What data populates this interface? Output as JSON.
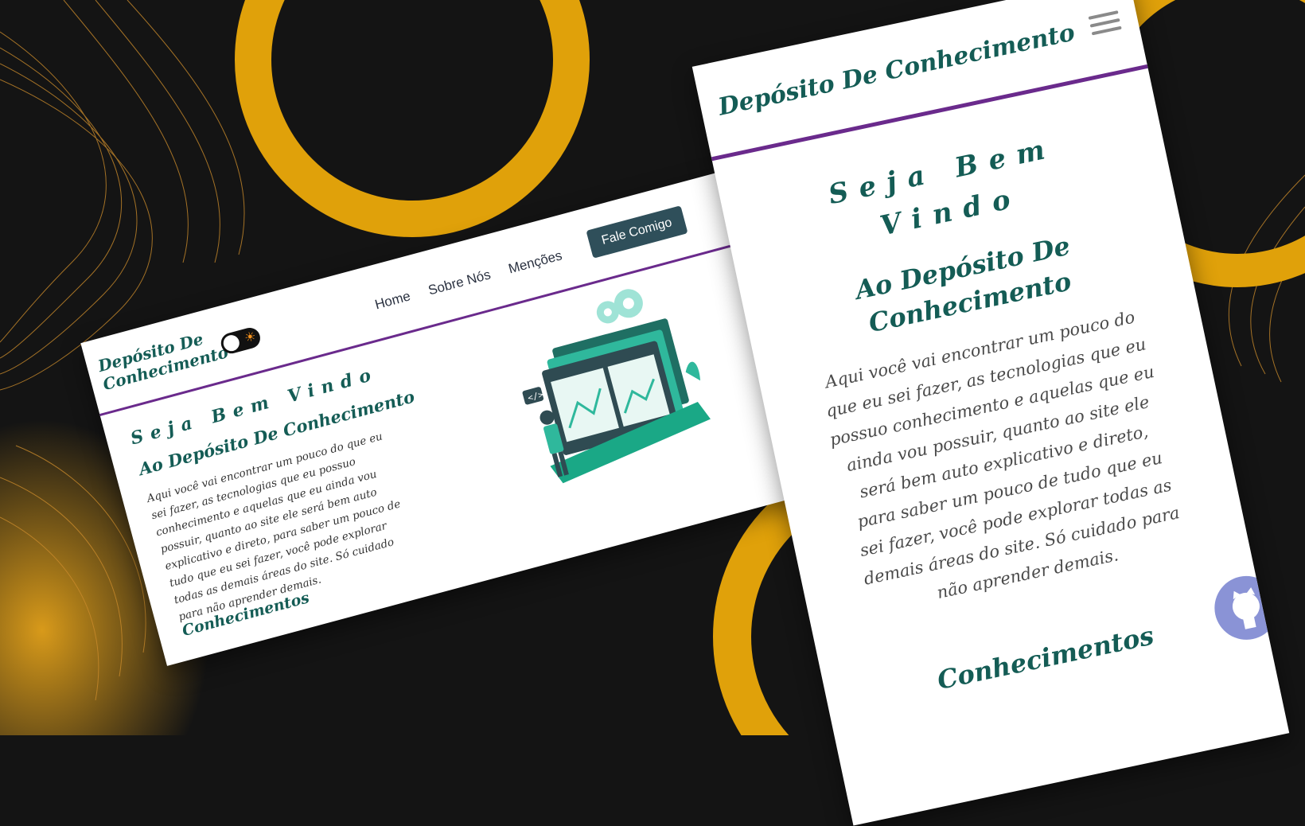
{
  "colors": {
    "background": "#141414",
    "accent_gold": "#e0a10a",
    "brand_teal": "#145c55",
    "divider_purple": "#6a2a8c",
    "cta_button": "#2f4f5a",
    "github_badge": "#8a93d6"
  },
  "desktop": {
    "logo": "Depósito De Conhecimento",
    "nav": [
      "Home",
      "Sobre Nós",
      "Menções"
    ],
    "cta": "Fale Comigo",
    "welcome": "Seja Bem Vindo",
    "subtitle": "Ao Depósito De Conhecimento",
    "paragraph": "Aqui você vai encontrar um pouco do que eu sei fazer, as tecnologias que eu possuo conhecimento e aquelas que eu ainda vou possuir, quanto ao site ele será bem auto explicativo e direto, para saber um pouco de tudo que eu sei fazer, você pode explorar todas as demais áreas do site. Só cuidado para não aprender demais.",
    "section": "Conhecimentos",
    "icons": [
      "theme-toggle-icon",
      "sun-icon",
      "developer-illustration",
      "gear-icon",
      "github-icon"
    ]
  },
  "mobile": {
    "logo": "Depósito De Conhecimento",
    "welcome": "Seja Bem Vindo",
    "subtitle": "Ao Depósito De Conhecimento",
    "paragraph": "Aqui você vai encontrar um pouco do que eu sei fazer, as tecnologias que eu possuo conhecimento e aquelas que eu ainda vou possuir, quanto ao site ele será bem auto explicativo e direto, para saber um pouco de tudo que eu sei fazer, você pode explorar todas as demais áreas do site. Só cuidado para não aprender demais.",
    "section": "Conhecimentos",
    "icons": [
      "menu-icon",
      "github-icon"
    ]
  }
}
